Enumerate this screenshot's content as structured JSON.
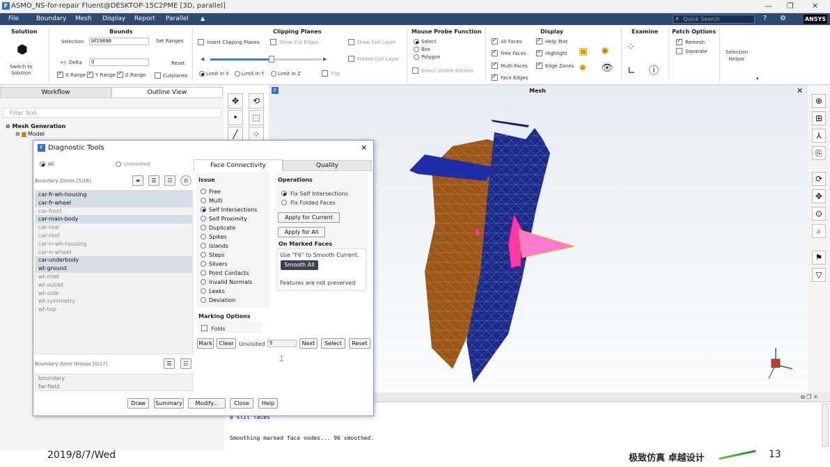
{
  "window": {
    "title": "ASMO_NS-for-repair Fluent@DESKTOP-15C2PME  [3D, parallel]",
    "app_icon": "F"
  },
  "menu": {
    "items": [
      "File",
      "Boundary",
      "Mesh",
      "Display",
      "Report",
      "Parallel"
    ],
    "quick_search_placeholder": "Quick Search",
    "brand": "ANSYS"
  },
  "ribbon": {
    "solution": {
      "title": "Solution",
      "switch_label": "Switch to\nSolution"
    },
    "bounds": {
      "title": "Bounds",
      "selection_label": "Selection",
      "selection_value": "bf19696",
      "set_ranges": "Set Ranges",
      "delta_label": "+/- Delta",
      "delta_value": "0",
      "reset": "Reset",
      "x_range": "X Range",
      "y_range": "Y Range",
      "z_range": "Z Range",
      "cutplanes": "Cutplanes"
    },
    "clipping": {
      "title": "Clipping Planes",
      "insert": "Insert Clipping Planes",
      "show_cut": "Show Cut Edges",
      "draw_cell": "Draw Cell Layer",
      "freeze_cell": "Freeze Cell Layer",
      "limit_x": "Limit in X",
      "limit_y": "Limit in Y",
      "limit_z": "Limit in Z",
      "flip": "Flip",
      "slider_position": 0.55
    },
    "probe": {
      "title": "Mouse Probe Function",
      "options": [
        "Select",
        "Box",
        "Polygon"
      ],
      "selected": 0,
      "select_visible": "Select Visible Entities"
    },
    "display": {
      "title": "Display",
      "all_faces": "All Faces",
      "free_faces": "Free Faces",
      "multi_faces": "Multi Faces",
      "face_edges": "Face Edges",
      "help_text": "Help Text",
      "highlight": "Highlight",
      "edge_zones": "Edge Zones"
    },
    "examine": {
      "title": "Examine"
    },
    "patch": {
      "title": "Patch Options",
      "remesh": "Remesh",
      "separate": "Separate"
    },
    "selection_helper": "Selection\nHelper"
  },
  "left": {
    "tabs": [
      "Workflow",
      "Outline View"
    ],
    "active_tab": 1,
    "filter_placeholder": "Filter Text",
    "tree": {
      "root": "Mesh Generation",
      "child": "Model"
    }
  },
  "viewport": {
    "title": "Mesh",
    "close": "✕",
    "icon": "F"
  },
  "console": {
    "lines": [
      "0 slit faces",
      "Smoothing marked face nodes... 96 smoothed."
    ]
  },
  "dialog": {
    "title": "Diagnostic Tools",
    "close": "✕",
    "filter_all": "All",
    "filter_unmeshed": "Unmeshed",
    "zones_label": "Boundary Zones [5/16]",
    "zones": [
      {
        "name": "car-fr-wh-housing",
        "sel": true
      },
      {
        "name": "car-fr-wheel",
        "sel": true
      },
      {
        "name": "car-front",
        "sel": false
      },
      {
        "name": "car-main-body",
        "sel": true
      },
      {
        "name": "car-rear",
        "sel": false
      },
      {
        "name": "car-roof",
        "sel": false
      },
      {
        "name": "car-rr-wh-housing",
        "sel": false
      },
      {
        "name": "car-rr-wheel",
        "sel": false
      },
      {
        "name": "car-underbody",
        "sel": true
      },
      {
        "name": "wt-ground",
        "sel": true
      },
      {
        "name": "wt-inlet",
        "sel": false
      },
      {
        "name": "wt-outlet",
        "sel": false
      },
      {
        "name": "wt-side",
        "sel": false
      },
      {
        "name": "wt-symmetry",
        "sel": false
      },
      {
        "name": "wt-top",
        "sel": false
      }
    ],
    "groups_label": "Boundary Zone Groups [0/17]",
    "groups": [
      "boundary",
      "far-field"
    ],
    "tabs": [
      "Face Connectivity",
      "Quality"
    ],
    "issue_title": "Issue",
    "issues": [
      "Free",
      "Multi",
      "Self Intersections",
      "Self Proximity",
      "Duplicate",
      "Spikes",
      "Islands",
      "Steps",
      "Slivers",
      "Point Contacts",
      "Invalid Normals",
      "Leaks",
      "Deviation"
    ],
    "issue_selected": 2,
    "operations_title": "Operations",
    "operations": [
      "Fix Self Intersections",
      "Fix Folded Faces"
    ],
    "operation_selected": 0,
    "apply_current": "Apply for Current",
    "apply_all": "Apply for All",
    "marked_title": "On Marked Faces",
    "marked_hint": "Use \"F6\" to Smooth Current.",
    "smooth_all": "Smooth All",
    "features_note": "Features are not preserved",
    "marking_title": "Marking Options",
    "folds": "Folds",
    "mark": "Mark",
    "clear": "Clear",
    "unvisited": "Unvisited",
    "unvisited_value": "5",
    "next": "Next",
    "select": "Select",
    "reset": "Reset",
    "footer": [
      "Draw",
      "Summary",
      "Modify...",
      "Close",
      "Help"
    ]
  },
  "footer": {
    "date": "2019/8/7/Wed",
    "slogan": "极致仿真 卓越设计",
    "page": "13"
  }
}
